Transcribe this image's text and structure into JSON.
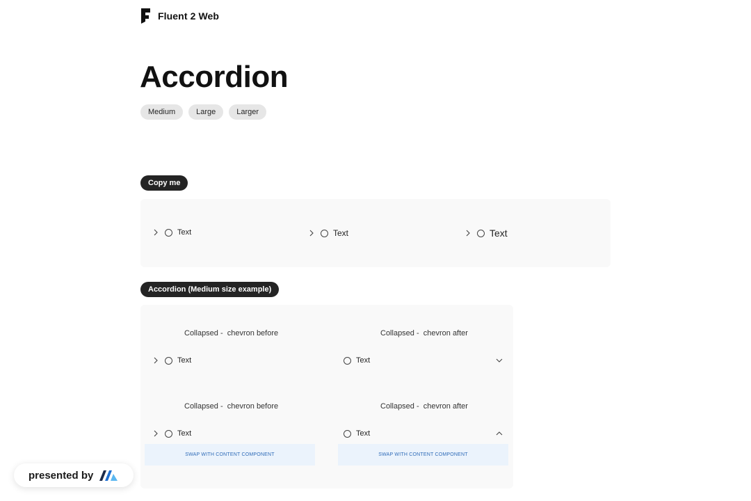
{
  "brand": {
    "name": "Fluent 2 Web"
  },
  "page": {
    "title": "Accordion"
  },
  "sizes": [
    "Medium",
    "Large",
    "Larger"
  ],
  "sections": {
    "copy_me": {
      "tag": "Copy me",
      "items": [
        {
          "label": "Text",
          "size": "Medium"
        },
        {
          "label": "Text",
          "size": "Large"
        },
        {
          "label": "Text",
          "size": "Larger"
        }
      ]
    },
    "medium_example": {
      "tag": "Accordion (Medium size example)",
      "examples": [
        {
          "caption": "Collapsed -  chevron before",
          "label": "Text",
          "chevron": "chevron-right-icon",
          "position": "before"
        },
        {
          "caption": "Collapsed -  chevron after",
          "label": "Text",
          "chevron": "chevron-down-icon",
          "position": "after"
        },
        {
          "caption": "Collapsed -  chevron before",
          "label": "Text",
          "chevron": "chevron-right-icon",
          "position": "before",
          "content": "SWAP WITH CONTENT COMPONENT"
        },
        {
          "caption": "Collapsed -  chevron after",
          "label": "Text",
          "chevron": "chevron-up-icon",
          "position": "after",
          "content": "SWAP WITH CONTENT COMPONENT"
        }
      ]
    }
  },
  "footer": {
    "presented_by": "presented by"
  },
  "colors": {
    "tag_bg": "#242424",
    "chip_bg": "#e6e6e6",
    "panel_bg": "#f9f9f9",
    "content_bg": "#ebf3fc",
    "content_text": "#2e6bb8"
  }
}
